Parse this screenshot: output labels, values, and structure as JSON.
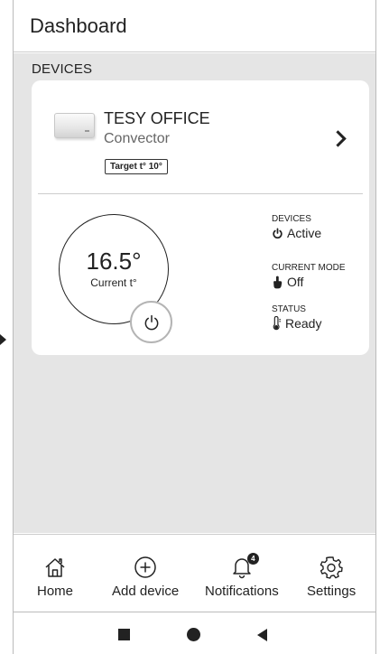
{
  "header": {
    "title": "Dashboard"
  },
  "section": {
    "label": "DEVICES"
  },
  "device": {
    "name": "TESY OFFICE",
    "type": "Convector",
    "target": "Target t° 10°",
    "current_temp": "16.5°",
    "current_label": "Current t°",
    "status": [
      {
        "label": "DEVICES",
        "value": "Active",
        "icon": "power-icon"
      },
      {
        "label": "CURRENT MODE",
        "value": "Off",
        "icon": "hand-icon"
      },
      {
        "label": "STATUS",
        "value": "Ready",
        "icon": "thermometer-icon"
      }
    ]
  },
  "nav": {
    "items": [
      {
        "label": "Home",
        "icon": "home-icon"
      },
      {
        "label": "Add device",
        "icon": "plus-circle-icon"
      },
      {
        "label": "Notifications",
        "icon": "bell-icon",
        "badge": "4"
      },
      {
        "label": "Settings",
        "icon": "gear-icon"
      }
    ]
  },
  "colors": {
    "background": "#e5e5e5",
    "card": "#ffffff",
    "text": "#222222",
    "ring": "#b4b4b4"
  }
}
